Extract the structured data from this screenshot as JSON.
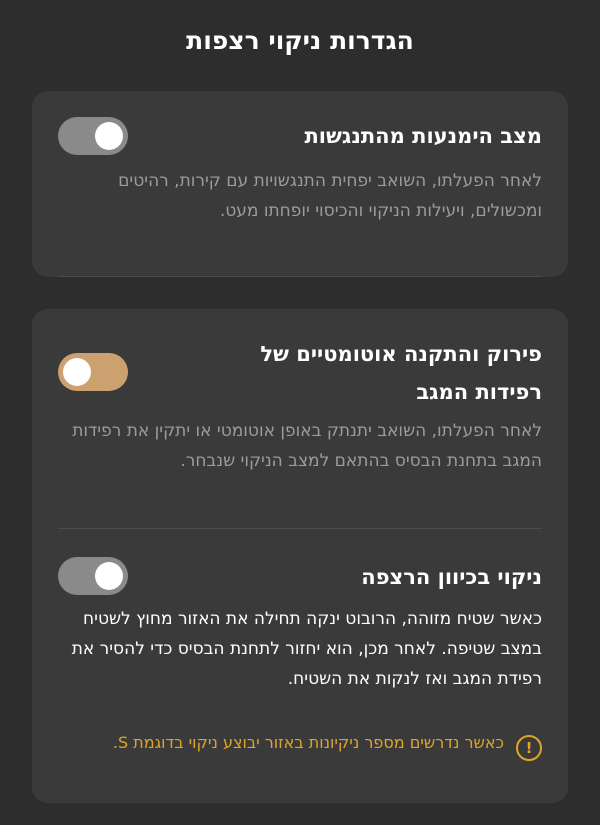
{
  "header": {
    "title": "הגדרות ניקוי רצפות"
  },
  "collision_avoidance": {
    "title": "מצב הימנעות מהתנגשות",
    "description": "לאחר הפעלתו, השואב יפחית התנגשויות עם קירות, רהיטים ומכשולים, ויעילות הניקוי והכיסוי יופחתו מעט.",
    "enabled": false
  },
  "mop_auto_detach": {
    "title": "פירוק והתקנה אוטומטיים של רפידות המגב",
    "description": "לאחר הפעלתו, השואב יתנתק באופן אוטומטי או יתקין את רפידות המגב בתחנת הבסיס בהתאם למצב הניקוי שנבחר.",
    "enabled": true
  },
  "floor_direction": {
    "title": "ניקוי בכיוון הרצפה",
    "description": "כאשר שטיח מזוהה, הרובוט ינקה תחילה את האזור מחוץ לשטיח במצב שטיפה. לאחר מכן, הוא יחזור לתחנת הבסיס כדי להסיר את רפידת המגב ואז לנקות את השטיח.",
    "enabled": false
  },
  "warning": {
    "icon": "exclamation-circle-icon",
    "text": "כאשר נדרשים מספר ניקיונות באזור יבוצע ניקוי בדוגמת S.",
    "color": "#e0a528"
  },
  "colors": {
    "background": "#2d2d2d",
    "card": "#3a3a3a",
    "toggle_on": "#cda06f",
    "toggle_off": "#8a8a8a"
  }
}
